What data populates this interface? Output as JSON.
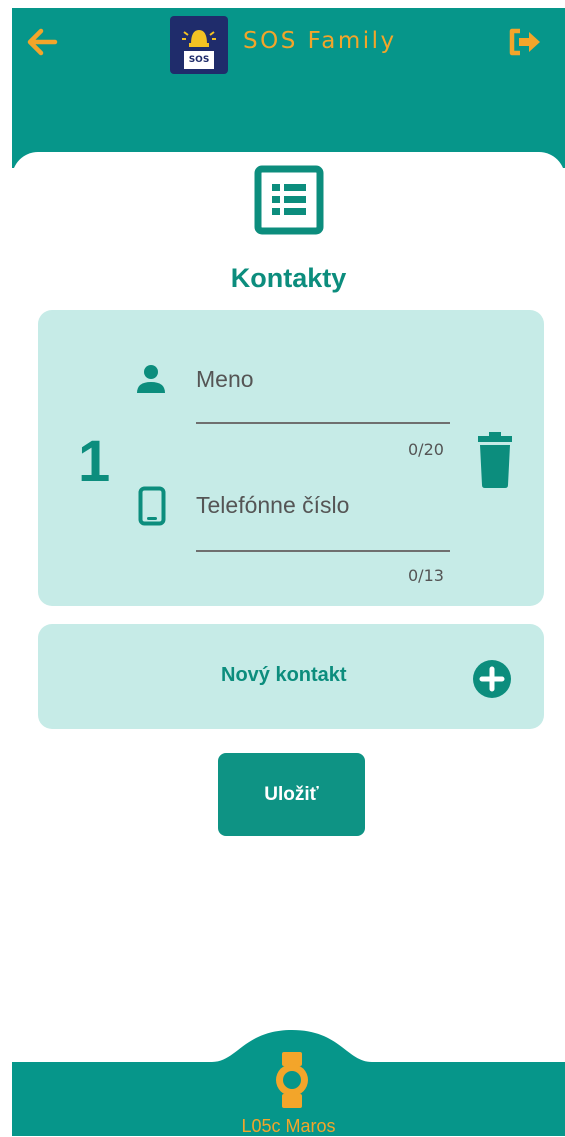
{
  "header": {
    "title": "SOS Family",
    "logo_text": "SOS",
    "back_icon": "arrow-left-icon",
    "logout_icon": "logout-icon"
  },
  "main": {
    "page_icon": "list-icon",
    "title": "Kontakty",
    "contacts": [
      {
        "number": "1",
        "name_field": {
          "placeholder": "Meno",
          "counter": "0/20",
          "icon": "person-icon"
        },
        "phone_field": {
          "placeholder": "Telefónne číslo",
          "counter": "0/13",
          "icon": "phone-icon"
        },
        "delete_icon": "trash-icon"
      }
    ],
    "new_contact": {
      "label": "Nový kontakt",
      "icon": "plus-circle-icon"
    },
    "save_label": "Uložiť"
  },
  "bottom_nav": {
    "device_name": "L05c Maros",
    "device_icon": "watch-icon"
  },
  "colors": {
    "primary": "#06968a",
    "accent": "#f3a52a",
    "card_bg": "#c6ebe7",
    "title_text": "#0c8d7d"
  }
}
